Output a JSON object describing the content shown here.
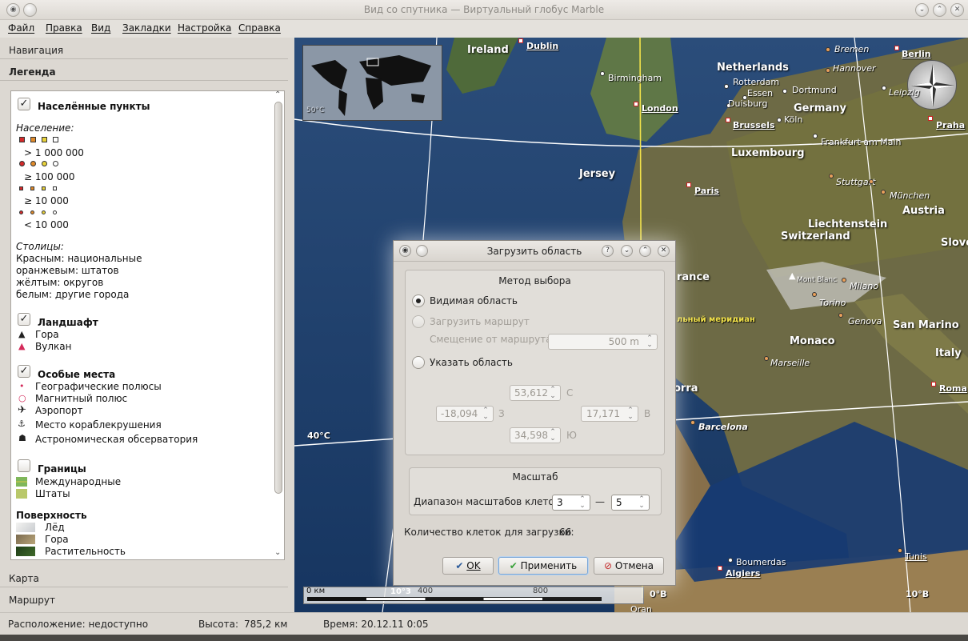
{
  "window": {
    "title": "Вид со спутника — Виртуальный глобус Marble"
  },
  "menu": [
    "Файл",
    "Правка",
    "Вид",
    "Закладки",
    "Настройка",
    "Справка"
  ],
  "panel": {
    "tabs": {
      "navigation": "Навигация",
      "legend": "Легенда",
      "map": "Карта",
      "route": "Маршрут"
    }
  },
  "legend": {
    "places": {
      "title": "Населённые пункты",
      "population_label": "Население:",
      "pop": [
        "> 1 000 000",
        "≥ 100 000",
        "≥ 10 000",
        "< 10 000"
      ],
      "capitals_label": "Столицы:",
      "capitals": [
        "Красным: национальные",
        "оранжевым: штатов",
        "жёлтым: округов",
        "белым: другие города"
      ]
    },
    "terrain": {
      "title": "Ландшафт",
      "items": [
        "Гора",
        "Вулкан"
      ]
    },
    "poi": {
      "title": "Особые места",
      "items": [
        "Географические полюсы",
        "Магнитный полюс",
        "Аэропорт",
        "Место кораблекрушения",
        "Астрономическая обсерватория"
      ]
    },
    "borders": {
      "title": "Границы",
      "items": [
        "Международные",
        "Штаты"
      ]
    },
    "surface": {
      "title": "Поверхность",
      "items": [
        "Лёд",
        "Гора",
        "Растительность"
      ]
    }
  },
  "map": {
    "countries": [
      "Ireland",
      "Netherlands",
      "Germany",
      "Luxembourg",
      "Jersey",
      "Austria",
      "Liechtenstein",
      "Switzerland",
      "Slove",
      "rance",
      "Monaco",
      "San Marino",
      "Italy",
      "orra"
    ],
    "capitals": [
      "Dublin",
      "London",
      "Brussels",
      "Berlin",
      "Praha",
      "Paris",
      "Roma",
      "Algiers",
      "Tunis"
    ],
    "cities": [
      "Birmingham",
      "Rotterdam",
      "Essen",
      "Dortmund",
      "Duisburg",
      "Köln",
      "Frankfurt am Main",
      "Mont Blanc",
      "Boumerdas",
      "Oran"
    ],
    "italic_cities": [
      "Bremen",
      "Hannover",
      "Leipzig",
      "Stuttgart",
      "München",
      "Milano",
      "Torino",
      "Genova",
      "Marseille",
      "Barcelona"
    ],
    "meridian_label": "льный меридиан",
    "lat_label": "40°C",
    "lat_top": "50°C",
    "lon_labels": [
      "10°3",
      "0°В",
      "10°В"
    ],
    "scale": {
      "zero": "0 км",
      "mid": "400",
      "max": "800"
    }
  },
  "dialog": {
    "title": "Загрузить область",
    "method_title": "Метод выбора",
    "visible_area": "Видимая область",
    "load_route": "Загрузить маршрут",
    "route_offset_label": "Смещение от маршрута:",
    "route_offset_value": "500 m",
    "specify_area": "Указать область",
    "north_value": "53,612",
    "north_label": "С",
    "west_value": "-18,094",
    "west_label": "З",
    "east_value": "17,171",
    "east_label": "В",
    "south_value": "34,598",
    "south_label": "Ю",
    "scale_title": "Масштаб",
    "tile_range_label": "Диапазон масштабов клеток:",
    "tile_from": "3",
    "tile_dash": "—",
    "tile_to": "5",
    "tile_count_label": "Количество клеток для загрузки:",
    "tile_count": "66",
    "ok": "OK",
    "apply": "Применить",
    "cancel": "Отмена"
  },
  "status": {
    "location": "Расположение: недоступно",
    "altitude_label": "Высота:",
    "altitude": "785,2 км",
    "time": "Время: 20.12.11 0:05"
  },
  "colors": {
    "cap_red": "#d42a2a",
    "cap_orange": "#e08a2a",
    "cap_yellow": "#e8d23a",
    "sea": "#1c3a66",
    "accent_focus": "#7aa7d8"
  }
}
